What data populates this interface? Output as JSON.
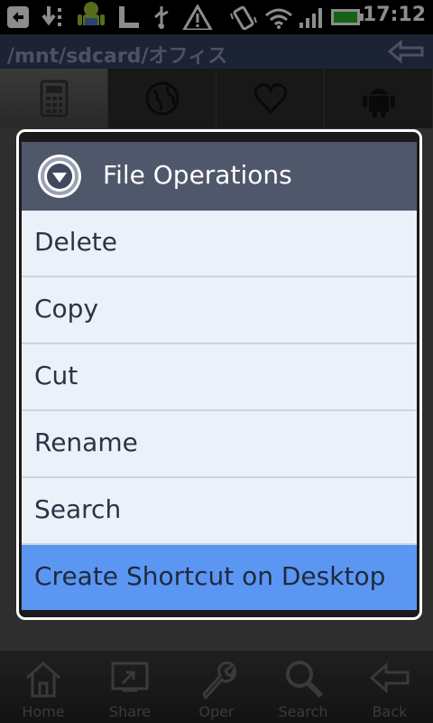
{
  "status_bar": {
    "time": "17:12"
  },
  "path_bar": {
    "path": "/mnt/sdcard/オフィス"
  },
  "tabs": [
    {
      "icon": "calculator-icon"
    },
    {
      "icon": "globe-icon"
    },
    {
      "icon": "heart-icon"
    },
    {
      "icon": "android-icon"
    }
  ],
  "dialog": {
    "title": "File Operations",
    "items": [
      {
        "label": "Delete"
      },
      {
        "label": "Copy"
      },
      {
        "label": "Cut"
      },
      {
        "label": "Rename"
      },
      {
        "label": "Search"
      },
      {
        "label": "Create Shortcut on Desktop",
        "highlighted": true
      }
    ]
  },
  "bottom_bar": {
    "items": [
      {
        "label": "Home",
        "icon": "home-icon"
      },
      {
        "label": "Share",
        "icon": "share-icon"
      },
      {
        "label": "Oper",
        "icon": "wrench-icon"
      },
      {
        "label": "Search",
        "icon": "search-icon"
      },
      {
        "label": "Back",
        "icon": "back-arrow-icon"
      }
    ]
  },
  "colors": {
    "accent": "#5b96f3",
    "path_bar": "#34405e",
    "dialog_header": "#4f576a",
    "menu_bg": "#eaf1f9"
  }
}
